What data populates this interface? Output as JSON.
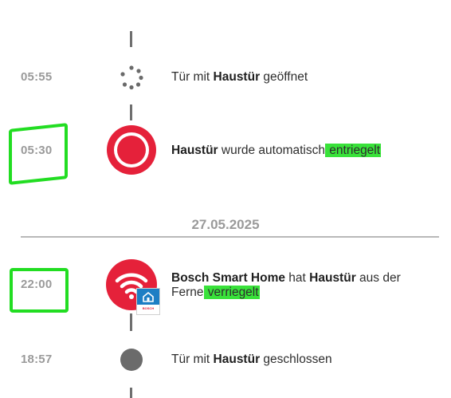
{
  "events": [
    {
      "time": "05:55",
      "pre": "Tür mit ",
      "bold": "Haustür",
      "post": " geöffnet"
    },
    {
      "time": "05:30",
      "bold": "Haustür",
      "post": " wurde automatisch",
      "highlight": " entriegelt"
    },
    {
      "time": "22:00",
      "bold1": "Bosch Smart Home",
      "mid": " hat ",
      "bold2": "Haustür",
      "post": " aus der",
      "line2": "Ferne",
      "highlight": " verriegelt"
    },
    {
      "time": "18:57",
      "pre": "Tür mit ",
      "bold": "Haustür",
      "post": " geschlossen"
    }
  ],
  "date_separator": "27.05.2025",
  "bosch_badge_text": "BOSCH",
  "colors": {
    "alert_red": "#e5213a",
    "highlight_green": "#39e23a",
    "annotation_green": "#22dd22",
    "timeline_grey": "#6f6f6f"
  },
  "icons": [
    "spinner-icon",
    "alarm-record-icon",
    "wifi-icon",
    "bosch-home-icon",
    "closed-dot-icon"
  ]
}
